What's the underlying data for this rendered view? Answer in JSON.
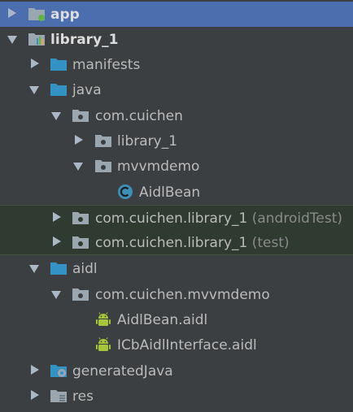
{
  "project_tree": {
    "app": {
      "label": "app"
    },
    "library_1": {
      "label": "library_1"
    },
    "manifests": {
      "label": "manifests"
    },
    "java": {
      "label": "java"
    },
    "com_cuichen": {
      "label": "com.cuichen"
    },
    "library_1_pkg": {
      "label": "library_1"
    },
    "mvvmdemo": {
      "label": "mvvmdemo"
    },
    "aidl_bean_class": {
      "label": "AidlBean"
    },
    "android_test_pkg": {
      "label": "com.cuichen.library_1",
      "suffix": "(androidTest)"
    },
    "test_pkg": {
      "label": "com.cuichen.library_1",
      "suffix": "(test)"
    },
    "aidl": {
      "label": "aidl"
    },
    "mvvmdemo_pkg": {
      "label": "com.cuichen.mvvmdemo"
    },
    "aidl_bean_file": {
      "label": "AidlBean.aidl"
    },
    "icb_interface_file": {
      "label": "ICbAidlInterface.aidl"
    },
    "generated_java": {
      "label": "generatedJava"
    },
    "res": {
      "label": "res"
    }
  },
  "colors": {
    "background": "#3c3f41",
    "selection": "#4b6eaf",
    "test_source_background": "#2f3a31",
    "folder_blue": "#3592c4",
    "android_green": "#a4c639",
    "class_badge": "#3d8fb5"
  },
  "icons": {
    "app": "android-module-icon",
    "library_1": "library-module-icon",
    "manifests": "folder-icon",
    "java": "source-folder-icon",
    "package": "package-icon",
    "class": "class-icon",
    "aidl": "source-folder-icon",
    "aidl_file": "android-icon",
    "generated_java": "generated-folder-icon",
    "res": "resources-folder-icon"
  }
}
